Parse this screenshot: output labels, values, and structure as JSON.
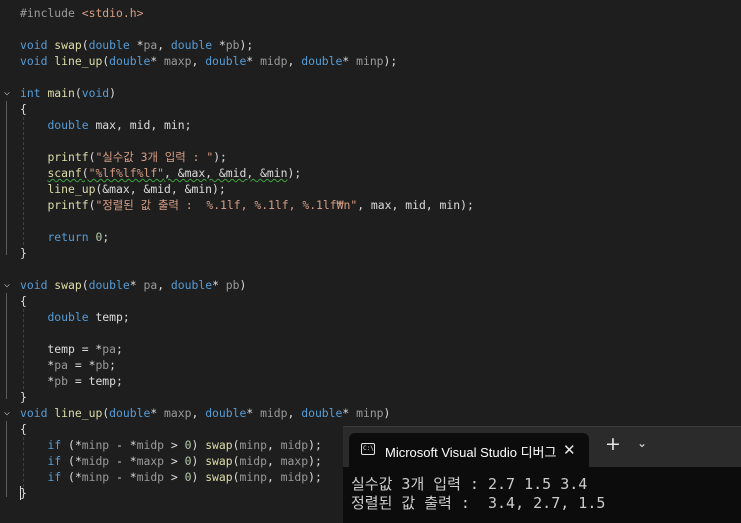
{
  "editor": {
    "lines": [
      "#include <stdio.h>",
      "",
      "void swap(double *pa, double *pb);",
      "void line_up(double* maxp, double* midp, double* minp);",
      "",
      "int main(void)",
      "{",
      "    double max, mid, min;",
      "",
      "    printf(\"실수값 3개 입력 : \");",
      "    scanf(\"%lf%lf%lf\", &max, &mid, &min);",
      "    line_up(&max, &mid, &min);",
      "    printf(\"정렬된 값 출력 :  %.1lf, %.1lf, %.1lf₩n\", max, mid, min);",
      "",
      "    return 0;",
      "}",
      "",
      "void swap(double* pa, double* pb)",
      "{",
      "    double temp;",
      "",
      "    temp = *pa;",
      "    *pa = *pb;",
      "    *pb = temp;",
      "}",
      "void line_up(double* maxp, double* midp, double* minp)",
      "{",
      "    if (*minp - *midp > 0) swap(minp, midp);",
      "    if (*midp - *maxp > 0) swap(midp, maxp);",
      "    if (*minp - *midp > 0) swap(minp, midp);",
      "}"
    ],
    "colors": {
      "background": "#1e1e1e",
      "keyword": "#569cd6",
      "function": "#dcdcaa",
      "string": "#d69d85",
      "number": "#b5cea8"
    }
  },
  "console": {
    "tab_title": "Microsoft Visual Studio 디버그",
    "tab_icon": "console-app-icon",
    "tab_icon_text": "C:\\",
    "close_glyph": "✕",
    "new_tab_glyph": "+",
    "dropdown_glyph": "⌄",
    "output": [
      "실수값 3개 입력 : 2.7 1.5 3.4",
      "정렬된 값 출력 :  3.4, 2.7, 1.5"
    ]
  }
}
